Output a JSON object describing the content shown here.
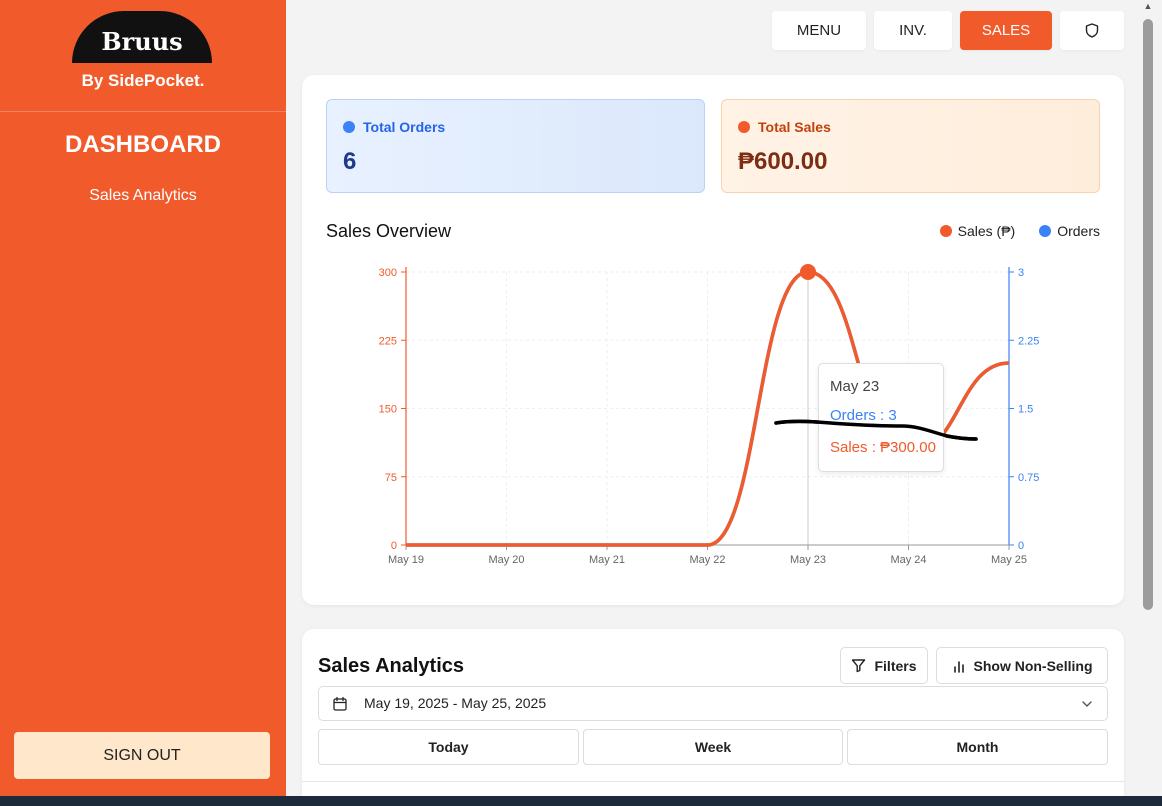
{
  "sidebar": {
    "logo_text": "Bruus",
    "byline": "By SidePocket.",
    "title": "DASHBOARD",
    "items": [
      {
        "label": "Sales Analytics"
      }
    ],
    "sign_out_label": "SIGN OUT"
  },
  "topnav": {
    "menu_label": "MENU",
    "inv_label": "INV.",
    "sales_label": "SALES",
    "active": "SALES",
    "shield_icon": "shield-icon"
  },
  "stats": {
    "orders": {
      "label": "Total Orders",
      "value": "6"
    },
    "sales": {
      "label": "Total Sales",
      "value": "₱600.00"
    }
  },
  "chart_title": "Sales Overview",
  "legend": {
    "sales": "Sales (₱)",
    "orders": "Orders"
  },
  "tooltip": {
    "date": "May 23",
    "orders": "Orders : 3",
    "sales": "Sales : ₱300.00"
  },
  "chart_data": {
    "type": "line",
    "title": "Sales Overview",
    "categories": [
      "May 19",
      "May 20",
      "May 21",
      "May 22",
      "May 23",
      "May 24",
      "May 25"
    ],
    "series": [
      {
        "name": "Sales (₱)",
        "axis": "left",
        "color": "#f15a2b",
        "values": [
          0,
          0,
          0,
          0,
          300,
          100,
          200
        ]
      },
      {
        "name": "Orders",
        "axis": "right",
        "color": "#3b82f6",
        "values": [
          0,
          0,
          0,
          0,
          3,
          1,
          2
        ]
      }
    ],
    "y_left": {
      "ylim": [
        0,
        300
      ],
      "ticks": [
        "0",
        "75",
        "150",
        "225",
        "300"
      ]
    },
    "y_right": {
      "ylim": [
        0,
        3
      ],
      "ticks": [
        "0",
        "0.75",
        "1.5",
        "2.25",
        "3"
      ]
    },
    "grid": true,
    "legend_position": "top-right",
    "highlight_category": "May 23"
  },
  "analytics": {
    "title": "Sales Analytics",
    "filters_label": "Filters",
    "non_selling_label": "Show Non-Selling",
    "date_range": "May 19, 2025 - May 25, 2025",
    "periods": [
      "Today",
      "Week",
      "Month"
    ]
  },
  "colors": {
    "accent": "#f15a2b",
    "orders_blue": "#3b82f6",
    "sidebar_bg": "#f15a2b"
  }
}
